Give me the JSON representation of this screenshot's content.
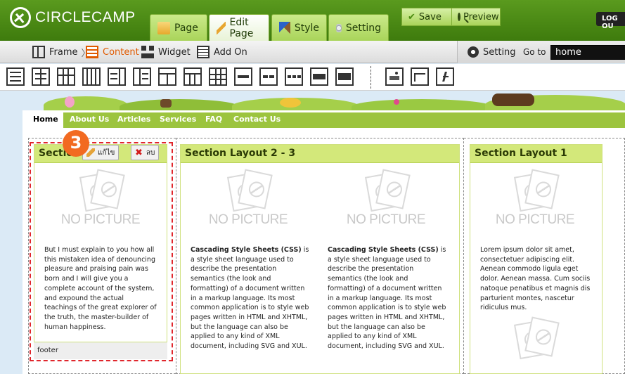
{
  "app": {
    "logo_text": "CIRCLECAMP",
    "logout": "LOG OU"
  },
  "main_tabs": [
    {
      "label": "Page",
      "icon": "page-icon"
    },
    {
      "label": "Edit Page",
      "icon": "edit-icon",
      "active": true
    },
    {
      "label": "Style",
      "icon": "style-icon"
    },
    {
      "label": "Setting",
      "icon": "gear-icon"
    }
  ],
  "actions": {
    "save": "Save",
    "preview": "Preview"
  },
  "toolbar2": {
    "frame": "Frame",
    "content": "Content",
    "widget": "Widget",
    "addon": "Add On",
    "setting": "Setting",
    "goto_label": "Go to",
    "goto_value": "home"
  },
  "site_nav": [
    "Home",
    "About Us",
    "Articles",
    "Services",
    "FAQ",
    "Contact Us"
  ],
  "no_picture": "NO PICTURE",
  "sections": {
    "s1": {
      "title": "Section",
      "edit": "แก้ไข",
      "delete": "ลบ",
      "body": "But I must explain to you how all this mistaken idea of denouncing pleasure and praising pain was born and I will give you a complete account of the system, and expound the actual teachings of the great explorer of the truth, the master-builder of human happiness.",
      "footer": "footer"
    },
    "s2": {
      "title": "Section Layout 2 - 3",
      "col_a_bold": "Cascading Style Sheets (CSS)",
      "col_a_rest": " is a style sheet language used to describe the presentation semantics (the look and formatting) of a document written in a markup language. Its most common application is to style web pages written in HTML and XHTML, but the language can also be applied to any kind of XML document, including SVG and XUL.",
      "col_b_bold": "Cascading Style Sheets (CSS)",
      "col_b_rest": " is a style sheet language used to describe the presentation semantics (the look and formatting) of a document written in a markup language. Its most common application is to style web pages written in HTML and XHTML, but the language can also be applied to any kind of XML document, including SVG and XUL."
    },
    "s3": {
      "title": "Section Layout 1",
      "body": "Lorem ipsum dolor sit amet, consectetuer adipiscing elit. Aenean commodo ligula eget dolor. Aenean massa. Cum sociis natoque penatibus et magnis dis parturient montes, nascetur ridiculus mus."
    }
  },
  "step_badge": "3",
  "colors": {
    "brand": "#3e7b0d",
    "nav": "#9cc43e",
    "section_header": "#d3e87a",
    "highlight": "#e0262c",
    "badge": "#f26a21"
  }
}
